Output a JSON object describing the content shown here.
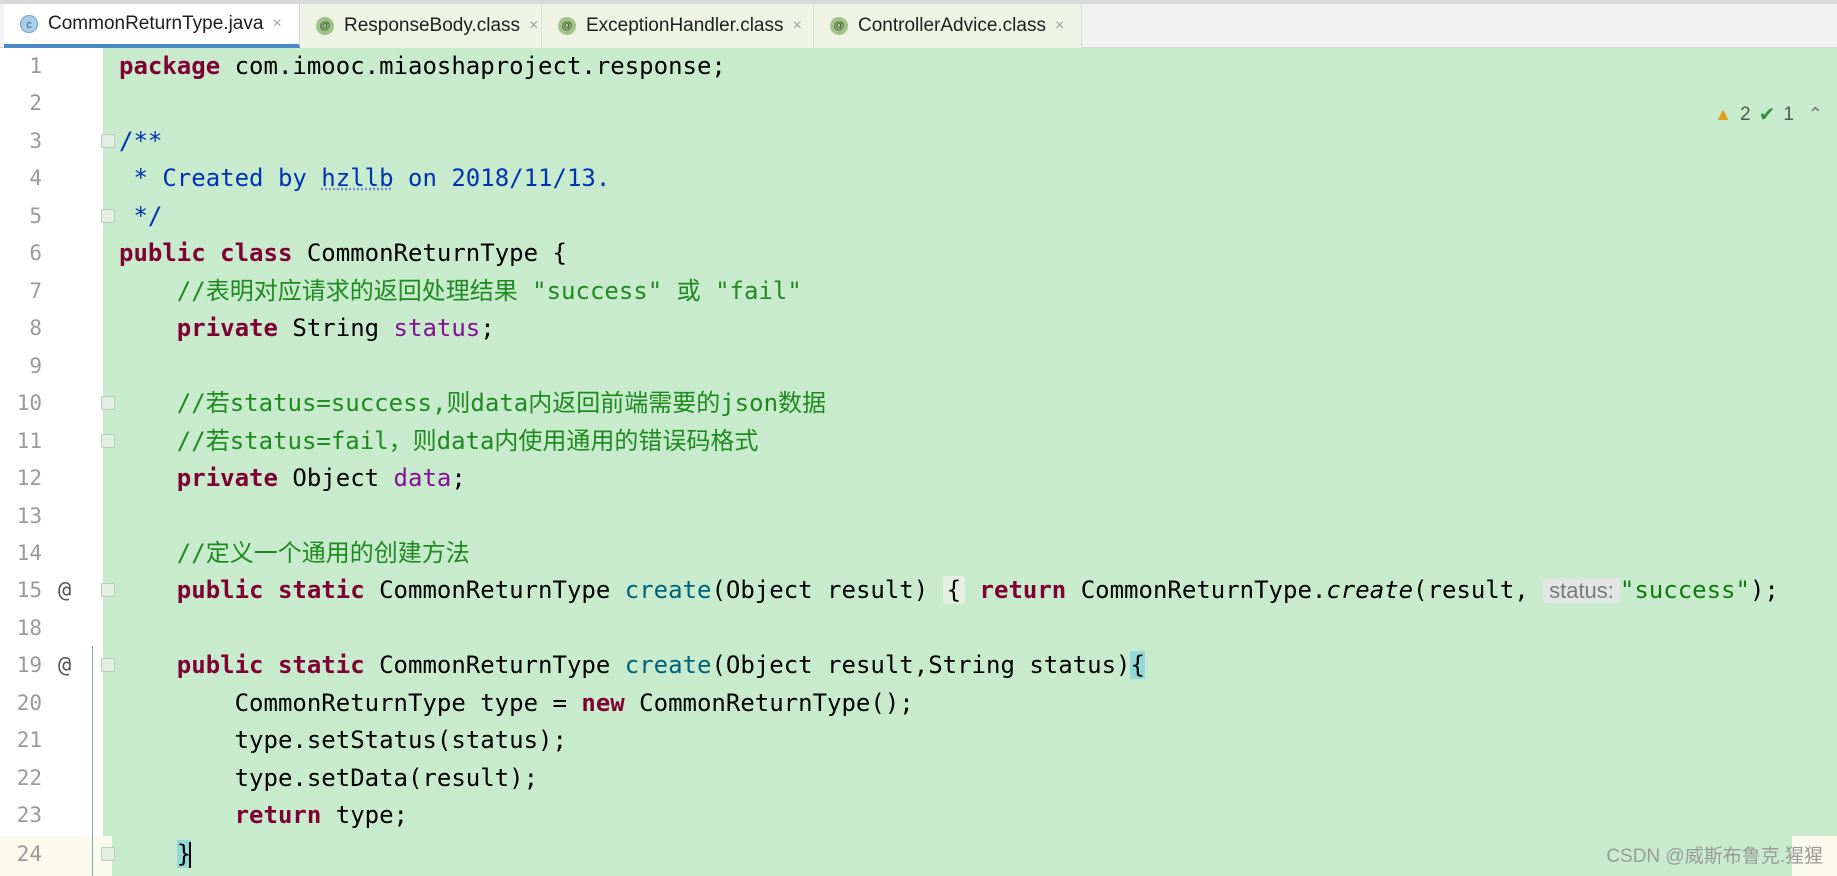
{
  "tabs": [
    {
      "label": "CommonReturnType.java",
      "icon": "c",
      "active": true
    },
    {
      "label": "ResponseBody.class",
      "icon": "@",
      "active": false
    },
    {
      "label": "ExceptionHandler.class",
      "icon": "@",
      "active": false
    },
    {
      "label": "ControllerAdvice.class",
      "icon": "@",
      "active": false
    }
  ],
  "tab_close": "×",
  "indicators": {
    "warnings": "2",
    "ok": "1"
  },
  "line_numbers": [
    "1",
    "2",
    "3",
    "4",
    "5",
    "6",
    "7",
    "8",
    "9",
    "10",
    "11",
    "12",
    "13",
    "14",
    "15",
    "18",
    "19",
    "20",
    "21",
    "22",
    "23",
    "24"
  ],
  "gutter_marks": {
    "line15": "@",
    "line19": "@"
  },
  "code": {
    "l1_kw": "package",
    "l1_rest": " com.imooc.miaoshaproject.response;",
    "l3": "/**",
    "l4_a": " * Created by ",
    "l4_b": "hzllb",
    "l4_c": " on 2018/11/13.",
    "l5": " */",
    "l6_kw1": "public",
    "l6_kw2": "class",
    "l6_rest": " CommonReturnType {",
    "l7": "    //表明对应请求的返回处理结果 \"success\" 或 \"fail\"",
    "l8_kw": "private",
    "l8_type": " String ",
    "l8_field": "status",
    "l8_end": ";",
    "l10": "    //若status=success,则data内返回前端需要的json数据",
    "l11": "    //若status=fail，则data内使用通用的错误码格式",
    "l12_kw": "private",
    "l12_type": " Object ",
    "l12_field": "data",
    "l12_end": ";",
    "l14": "    //定义一个通用的创建方法",
    "l15_kw1": "public",
    "l15_kw2": "static",
    "l15_type": " CommonReturnType ",
    "l15_m": "create",
    "l15_args": "(Object result) ",
    "l15_fold": "{",
    "l15_kw3": "return",
    "l15_cls": " CommonReturnType.",
    "l15_call": "create",
    "l15_open": "(result, ",
    "l15_hint": "status:",
    "l15_str": "\"success\"",
    "l15_end": ");",
    "l19_kw1": "public",
    "l19_kw2": "static",
    "l19_type": " CommonReturnType ",
    "l19_m": "create",
    "l19_args": "(Object result,String status)",
    "l19_brace": "{",
    "l20_a": "CommonReturnType type = ",
    "l20_kw": "new",
    "l20_b": " CommonReturnType();",
    "l21": "type.setStatus(status);",
    "l22": "type.setData(result);",
    "l23_kw": "return",
    "l23_b": " type;",
    "l24": "}"
  },
  "watermark": "CSDN @威斯布鲁克.猩猩"
}
